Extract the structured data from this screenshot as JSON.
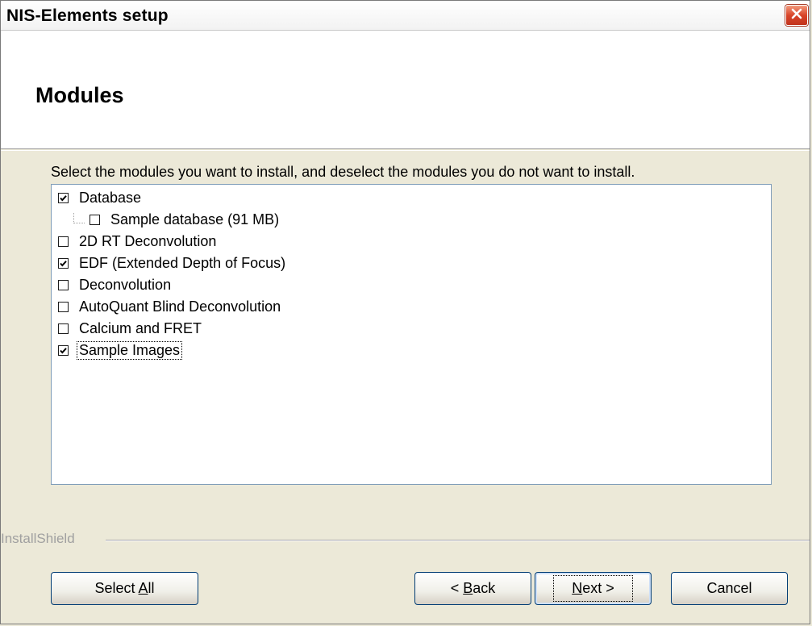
{
  "window": {
    "title": "NIS-Elements setup",
    "close_icon": "close-icon"
  },
  "header": {
    "title": "Modules"
  },
  "content": {
    "instructions": "Select the modules you want to install, and deselect the modules you do not want to install.",
    "modules": [
      {
        "label": "Database",
        "checked": true,
        "indent": 0
      },
      {
        "label": "Sample database (91 MB)",
        "checked": false,
        "indent": 1
      },
      {
        "label": "2D RT Deconvolution",
        "checked": false,
        "indent": 0
      },
      {
        "label": "EDF (Extended Depth of Focus)",
        "checked": true,
        "indent": 0
      },
      {
        "label": "Deconvolution",
        "checked": false,
        "indent": 0
      },
      {
        "label": "AutoQuant Blind Deconvolution",
        "checked": false,
        "indent": 0
      },
      {
        "label": "Calcium and FRET",
        "checked": false,
        "indent": 0
      },
      {
        "label": "Sample Images",
        "checked": true,
        "indent": 0,
        "focused": true
      }
    ]
  },
  "footer": {
    "brand": "InstallShield",
    "buttons": {
      "select_all": {
        "pre": "Select ",
        "mnemonic": "A",
        "post": "ll"
      },
      "back": {
        "pre": "< ",
        "mnemonic": "B",
        "post": "ack"
      },
      "next": {
        "pre": "",
        "mnemonic": "N",
        "post": "ext >"
      },
      "cancel": {
        "label": "Cancel"
      }
    }
  },
  "colors": {
    "window_bg": "#ece9d8",
    "tree_border": "#7f9db9",
    "button_border": "#003c74",
    "close_red": "#d8452a"
  }
}
